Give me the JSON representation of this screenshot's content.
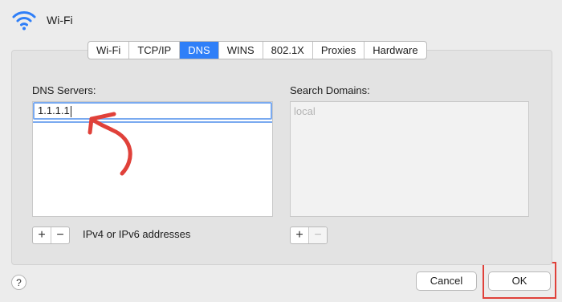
{
  "window": {
    "title": "Wi-Fi",
    "icon": "wifi-icon"
  },
  "tabs": [
    {
      "label": "Wi-Fi",
      "active": false
    },
    {
      "label": "TCP/IP",
      "active": false
    },
    {
      "label": "DNS",
      "active": true
    },
    {
      "label": "WINS",
      "active": false
    },
    {
      "label": "802.1X",
      "active": false
    },
    {
      "label": "Proxies",
      "active": false
    },
    {
      "label": "Hardware",
      "active": false
    }
  ],
  "dns_servers": {
    "label": "DNS Servers:",
    "entries": [
      "1.1.1.1"
    ],
    "add_label": "+",
    "remove_label": "−",
    "hint": "IPv4 or IPv6 addresses"
  },
  "search_domains": {
    "label": "Search Domains:",
    "placeholder": "local",
    "add_label": "+",
    "remove_label": "−"
  },
  "footer": {
    "help_label": "?",
    "cancel_label": "Cancel",
    "ok_label": "OK"
  },
  "colors": {
    "accent": "#2f7ff8",
    "annotation": "#e0413a",
    "background": "#ececec"
  }
}
